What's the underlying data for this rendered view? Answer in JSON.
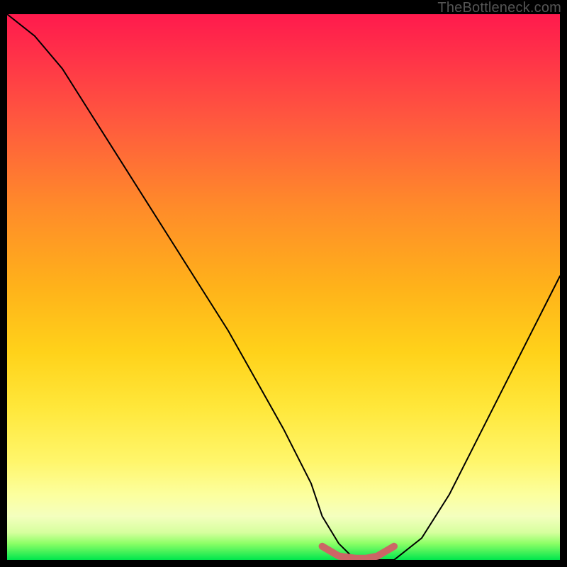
{
  "watermark": "TheBottleneck.com",
  "chart_data": {
    "type": "line",
    "title": "",
    "xlabel": "",
    "ylabel": "",
    "xlim": [
      0,
      100
    ],
    "ylim": [
      0,
      100
    ],
    "series": [
      {
        "name": "bottleneck-curve",
        "x": [
          0,
          5,
          10,
          15,
          20,
          25,
          30,
          35,
          40,
          45,
          50,
          55,
          57,
          60,
          63,
          65,
          67,
          70,
          75,
          80,
          85,
          90,
          95,
          100
        ],
        "y": [
          100,
          96,
          90,
          82,
          74,
          66,
          58,
          50,
          42,
          33,
          24,
          14,
          8,
          3,
          0,
          0,
          0,
          0,
          4,
          12,
          22,
          32,
          42,
          52
        ]
      }
    ],
    "highlight_segment": {
      "name": "valley-flat",
      "color": "#cc6666",
      "x": [
        57,
        60,
        63,
        65,
        67,
        70
      ],
      "y": [
        2.5,
        0.7,
        0.3,
        0.3,
        0.7,
        2.5
      ]
    },
    "background_gradient": {
      "top": "#ff1a4d",
      "mid": "#ffd21a",
      "bottom": "#00e64d"
    }
  }
}
